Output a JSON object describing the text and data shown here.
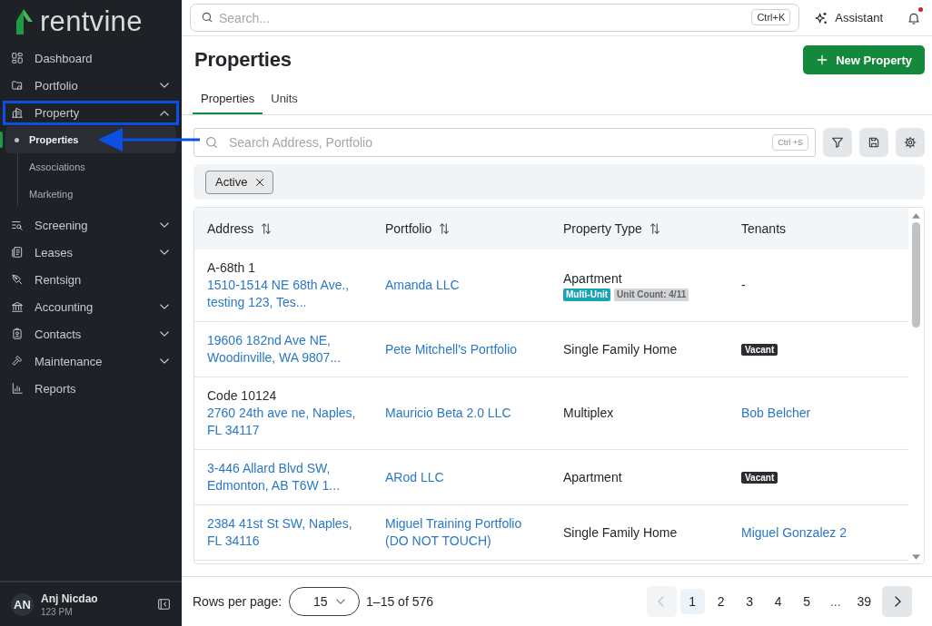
{
  "sidebar": {
    "logo": "rentvine",
    "items": [
      {
        "label": "Dashboard",
        "selected": false,
        "framed": false
      },
      {
        "label": "Portfolio",
        "selected": false,
        "framed": false,
        "expanded": false
      },
      {
        "label": "Property",
        "selected": false,
        "framed": true,
        "expanded": true,
        "children": [
          {
            "label": "Properties",
            "selected": true,
            "pointed_at": true
          },
          {
            "label": "Associations",
            "selected": false,
            "pointed_at": false
          },
          {
            "label": "Marketing",
            "selected": false,
            "pointed_at": false
          }
        ]
      },
      {
        "label": "Screening",
        "selected": false,
        "framed": false,
        "expanded": false
      },
      {
        "label": "Leases",
        "selected": false,
        "framed": false,
        "expanded": false
      },
      {
        "label": "Rentsign",
        "selected": false,
        "framed": false
      },
      {
        "label": "Accounting",
        "selected": false,
        "framed": false,
        "expanded": false
      },
      {
        "label": "Contacts",
        "selected": false,
        "framed": false,
        "expanded": false
      },
      {
        "label": "Maintenance",
        "selected": false,
        "framed": false,
        "expanded": false
      },
      {
        "label": "Reports",
        "selected": false,
        "framed": false
      }
    ],
    "user": {
      "initials": "AN",
      "name": "Anj Nicdao",
      "subtitle": "123 PM"
    }
  },
  "topbar": {
    "search": {
      "placeholder": "Search...",
      "shortcut": "Ctrl+K"
    },
    "assistant": "Assistant",
    "notifications": {
      "unread": true
    }
  },
  "page": {
    "title": "Properties",
    "primary_button": "New Property",
    "tabs": [
      {
        "label": "Properties",
        "selected": true
      },
      {
        "label": "Units",
        "selected": false
      }
    ],
    "search": {
      "placeholder": "Search Address, Portfolio",
      "shortcut": "Ctrl +S"
    },
    "filters": [
      {
        "label": "Active"
      }
    ]
  },
  "table": {
    "columns": [
      {
        "label": "Address",
        "sortable": true
      },
      {
        "label": "Portfolio",
        "sortable": true
      },
      {
        "label": "Property Type",
        "sortable": true
      },
      {
        "label": "Tenants",
        "sortable": false
      }
    ],
    "rows": [
      {
        "code": "A-68th 1",
        "address": "1510-1514 NE 68th Ave., testing 123, Tes...",
        "portfolio": "Amanda LLC",
        "property_type": "Apartment",
        "type_badges": [
          {
            "label": "Multi-Unit",
            "kind": "accent"
          },
          {
            "label": "Unit Count: 4/11",
            "kind": "muted"
          }
        ],
        "tenant": {
          "kind": "text",
          "label": "-"
        }
      },
      {
        "address": "19606 182nd Ave NE, Woodinville, WA 9807...",
        "portfolio": "Pete Mitchell's Portfolio",
        "property_type": "Single Family Home",
        "tenant": {
          "kind": "badge",
          "label": "Vacant"
        }
      },
      {
        "code": "Code 10124",
        "address": "2760 24th ave ne, Naples, FL 34117",
        "portfolio": "Mauricio Beta 2.0 LLC",
        "property_type": "Multiplex",
        "tenant": {
          "kind": "link",
          "label": "Bob Belcher"
        }
      },
      {
        "address": "3-446 Allard Blvd SW, Edmonton, AB T6W 1...",
        "portfolio": "ARod LLC",
        "property_type": "Apartment",
        "tenant": {
          "kind": "badge",
          "label": "Vacant"
        }
      },
      {
        "address": "2384 41st St SW, Naples, FL 34116",
        "portfolio": "Miguel Training Portfolio (DO NOT TOUCH)",
        "property_type": "Single Family Home",
        "tenant": {
          "kind": "link",
          "label": "Miguel Gonzalez 2"
        }
      }
    ]
  },
  "pagination": {
    "rows_per_page_label": "Rows per page:",
    "rows_per_page": "15",
    "range": "1–15 of 576",
    "previous": {
      "disabled": true
    },
    "next": {
      "disabled": false
    },
    "pages": [
      {
        "label": "1",
        "kind": "page",
        "selected": true
      },
      {
        "label": "2",
        "kind": "page",
        "selected": false
      },
      {
        "label": "3",
        "kind": "page",
        "selected": false
      },
      {
        "label": "4",
        "kind": "page",
        "selected": false
      },
      {
        "label": "5",
        "kind": "page",
        "selected": false
      },
      {
        "label": "...",
        "kind": "ellipsis",
        "selected": false
      },
      {
        "label": "39",
        "kind": "page",
        "selected": false
      }
    ]
  }
}
